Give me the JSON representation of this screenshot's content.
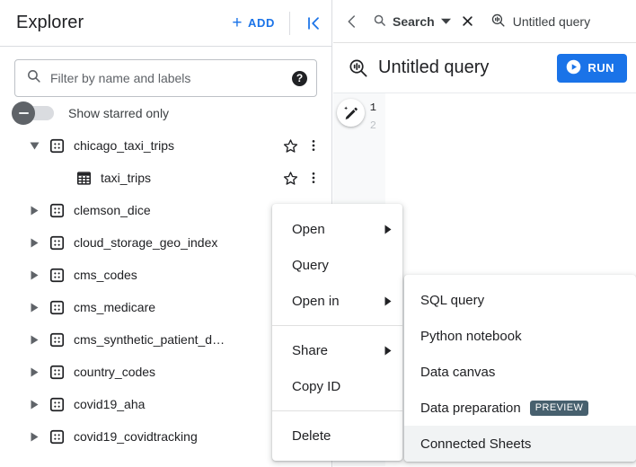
{
  "explorer": {
    "title": "Explorer",
    "add_label": "ADD",
    "collapse_icon": "collapse-panel-icon",
    "filter": {
      "placeholder": "Filter by name and labels",
      "value": "",
      "search_icon": "search-icon",
      "help_icon": "help-icon"
    },
    "starred_toggle": {
      "label": "Show starred only",
      "state": "off"
    },
    "tree": [
      {
        "label": "chicago_taxi_trips",
        "type": "dataset",
        "expanded": true,
        "indent": 0,
        "has_more": true
      },
      {
        "label": "taxi_trips",
        "type": "table",
        "expanded": false,
        "indent": 1,
        "has_more": true
      },
      {
        "label": "clemson_dice",
        "type": "dataset",
        "expanded": false,
        "indent": 0,
        "has_more": false
      },
      {
        "label": "cloud_storage_geo_index",
        "type": "dataset",
        "expanded": false,
        "indent": 0,
        "has_more": false
      },
      {
        "label": "cms_codes",
        "type": "dataset",
        "expanded": false,
        "indent": 0,
        "has_more": false
      },
      {
        "label": "cms_medicare",
        "type": "dataset",
        "expanded": false,
        "indent": 0,
        "has_more": false
      },
      {
        "label": "cms_synthetic_patient_d…",
        "type": "dataset",
        "expanded": false,
        "indent": 0,
        "has_more": false
      },
      {
        "label": "country_codes",
        "type": "dataset",
        "expanded": false,
        "indent": 0,
        "has_more": false
      },
      {
        "label": "covid19_aha",
        "type": "dataset",
        "expanded": false,
        "indent": 0,
        "has_more": false
      },
      {
        "label": "covid19_covidtracking",
        "type": "dataset",
        "expanded": false,
        "indent": 0,
        "has_more": false
      }
    ]
  },
  "tabbar": {
    "back_icon": "chevron-left-icon",
    "search_tab": {
      "label": "Search",
      "icon": "search-icon",
      "dropdown_icon": "caret-down-icon"
    },
    "close_icon": "close-icon",
    "query_tab": {
      "label": "Untitled query",
      "icon": "query-icon"
    }
  },
  "query_header": {
    "icon": "query-icon",
    "title": "Untitled query",
    "run_label": "RUN",
    "run_icon": "play-icon",
    "run_color": "#1a73e8"
  },
  "editor": {
    "line_numbers": [
      "1",
      "2"
    ],
    "magic_icon": "magic-pencil-icon",
    "code": ""
  },
  "context_menu": {
    "items": [
      {
        "label": "Open",
        "submenu": true
      },
      {
        "label": "Query",
        "submenu": false
      },
      {
        "label": "Open in",
        "submenu": true
      },
      {
        "separator": true
      },
      {
        "label": "Share",
        "submenu": true
      },
      {
        "label": "Copy ID",
        "submenu": false
      },
      {
        "separator": true
      },
      {
        "label": "Delete",
        "submenu": false
      }
    ]
  },
  "sub_menu": {
    "items": [
      {
        "label": "SQL query",
        "badge": null,
        "selected": false
      },
      {
        "label": "Python notebook",
        "badge": null,
        "selected": false
      },
      {
        "label": "Data canvas",
        "badge": null,
        "selected": false
      },
      {
        "label": "Data preparation",
        "badge": "PREVIEW",
        "selected": false
      },
      {
        "label": "Connected Sheets",
        "badge": null,
        "selected": true
      }
    ],
    "badge_color": "#47606e"
  }
}
